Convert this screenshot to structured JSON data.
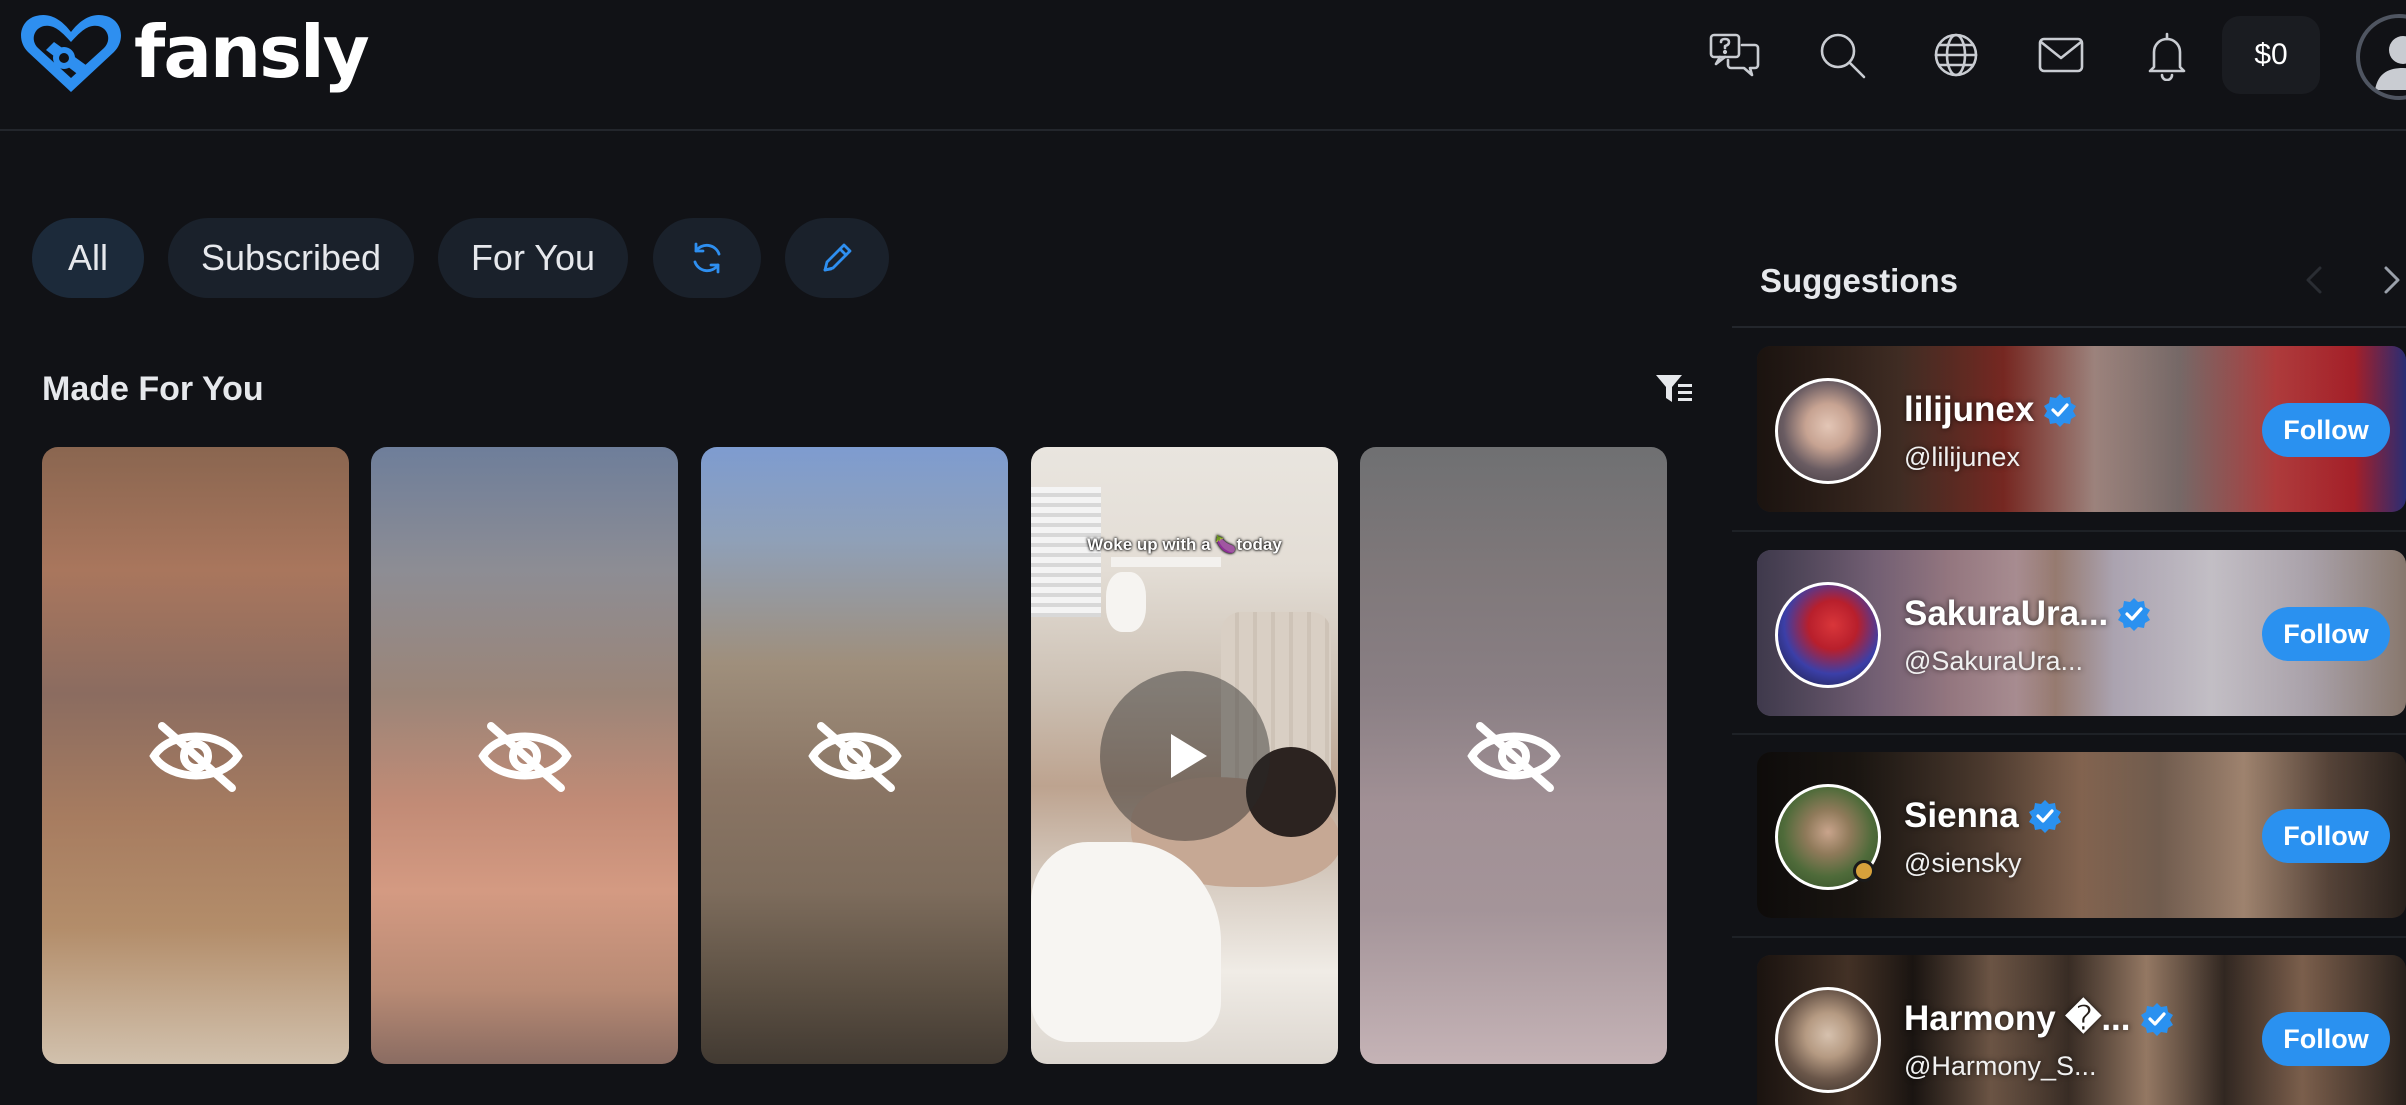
{
  "header": {
    "brand": "fansly",
    "icons": [
      "faq-chat-icon",
      "search-icon",
      "globe-icon",
      "mail-icon",
      "bell-icon"
    ],
    "wallet": "$0"
  },
  "filters": {
    "tabs": [
      {
        "label": "All",
        "active": true
      },
      {
        "label": "Subscribed",
        "active": false
      },
      {
        "label": "For You",
        "active": false
      }
    ],
    "icons": [
      "refresh-icon",
      "pencil-icon"
    ]
  },
  "main": {
    "section_title": "Made For You",
    "cards": [
      {
        "type": "hidden"
      },
      {
        "type": "hidden"
      },
      {
        "type": "hidden"
      },
      {
        "type": "video",
        "caption": "Woke up with a 🍆today"
      },
      {
        "type": "hidden"
      }
    ]
  },
  "suggestions": {
    "title": "Suggestions",
    "items": [
      {
        "name": "lilijunex",
        "handle": "@lilijunex",
        "verified": true,
        "follow_label": "Follow"
      },
      {
        "name": "SakuraUra...",
        "handle": "@SakuraUra...",
        "verified": true,
        "follow_label": "Follow"
      },
      {
        "name": "Sienna",
        "handle": "@siensky",
        "verified": true,
        "follow_label": "Follow",
        "online": true
      },
      {
        "name": "Harmony �...",
        "handle": "@Harmony_S...",
        "verified": true,
        "follow_label": "Follow"
      }
    ]
  },
  "colors": {
    "background": "#111216",
    "accent": "#2a91f0",
    "pill": "#1a212b",
    "logo": "#2e8ff0"
  }
}
